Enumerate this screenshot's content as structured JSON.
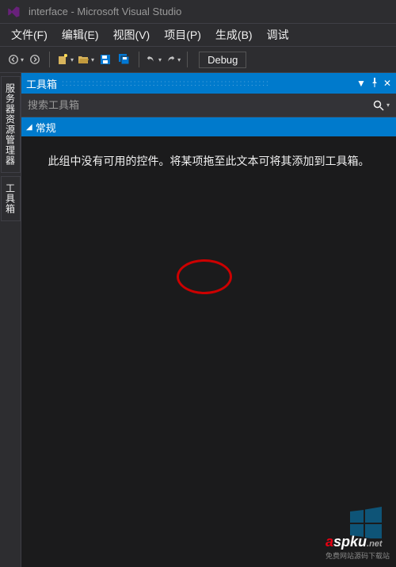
{
  "titlebar": {
    "title": "interface - Microsoft Visual Studio"
  },
  "menubar": {
    "file": "文件(F)",
    "edit": "编辑(E)",
    "view": "视图(V)",
    "project": "项目(P)",
    "build": "生成(B)",
    "debug": "调试"
  },
  "toolbar": {
    "debug_label": "Debug"
  },
  "sidetabs": {
    "server_explorer": "服务器资源管理器",
    "toolbox": "工具箱"
  },
  "toolbox_panel": {
    "title": "工具箱",
    "search_placeholder": "搜索工具箱",
    "category_general": "常规",
    "empty_message": "此组中没有可用的控件。将某项拖至此文本可将其添加到工具箱。"
  },
  "watermark": {
    "brand_a": "a",
    "brand_rest": "spku",
    "suffix": ".net",
    "tagline": "免费网站源码下载站"
  }
}
